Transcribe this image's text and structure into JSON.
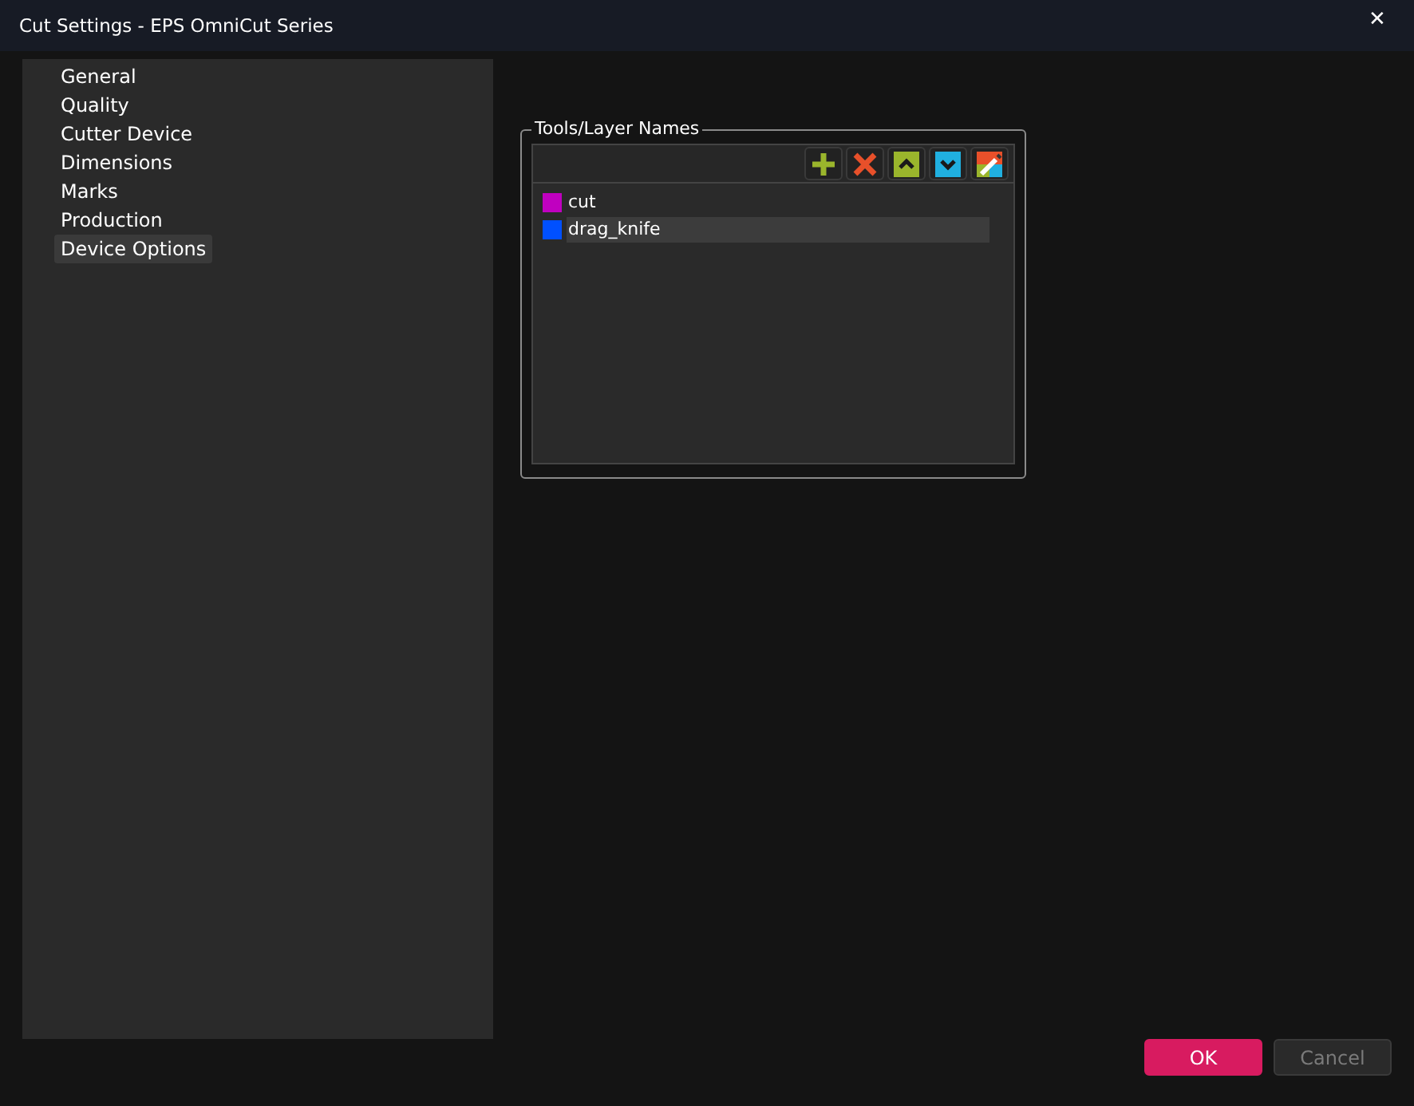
{
  "window": {
    "title": "Cut Settings - EPS OmniCut Series",
    "close": "✕"
  },
  "sidebar": {
    "items": [
      {
        "label": "General",
        "selected": false
      },
      {
        "label": "Quality",
        "selected": false
      },
      {
        "label": "Cutter Device",
        "selected": false
      },
      {
        "label": "Dimensions",
        "selected": false
      },
      {
        "label": "Marks",
        "selected": false
      },
      {
        "label": "Production",
        "selected": false
      },
      {
        "label": "Device Options",
        "selected": true
      }
    ]
  },
  "group": {
    "title": "Tools/Layer Names",
    "toolbar": [
      {
        "kind": "add"
      },
      {
        "kind": "delete"
      },
      {
        "kind": "up"
      },
      {
        "kind": "down"
      },
      {
        "kind": "color"
      }
    ],
    "layers": [
      {
        "name": "cut",
        "color": "#c000c0",
        "selected": false
      },
      {
        "name": "drag_knife",
        "color": "#0050ff",
        "selected": true
      }
    ]
  },
  "buttons": [
    {
      "label": "OK",
      "kind": "primary",
      "disabled": false
    },
    {
      "label": "Cancel",
      "kind": "secondary",
      "disabled": true
    }
  ]
}
